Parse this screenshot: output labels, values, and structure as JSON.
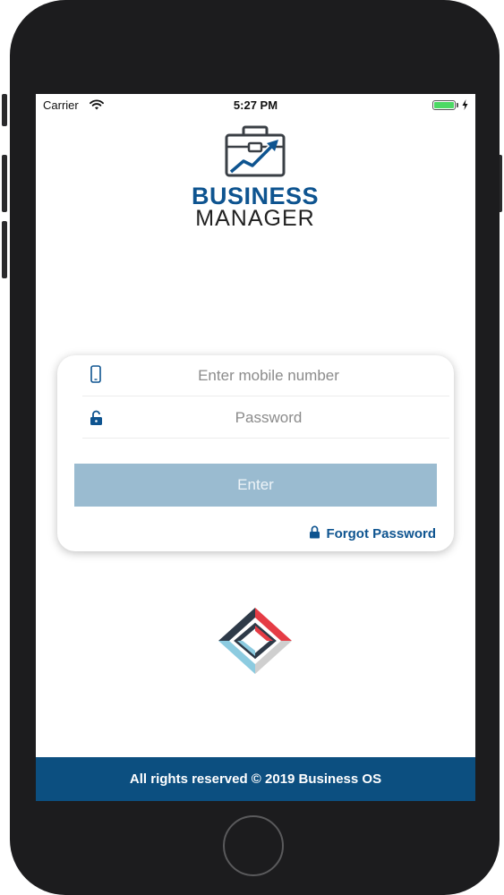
{
  "status_bar": {
    "carrier": "Carrier",
    "time": "5:27 PM",
    "battery_level_pct": 100
  },
  "logo": {
    "line1": "BUSINESS",
    "line2": "MANAGER",
    "icon": "briefcase-growth-icon"
  },
  "login": {
    "mobile": {
      "value": "",
      "placeholder": "Enter mobile number",
      "icon": "mobile-phone-icon"
    },
    "password": {
      "value": "",
      "placeholder": "Password",
      "icon": "lock-icon"
    },
    "enter_label": "Enter",
    "forgot_label": "Forgot Password",
    "forgot_icon": "lock-icon"
  },
  "brand_mark_icon": "diamond-logo-icon",
  "footer": {
    "text": "All rights reserved © 2019 Business OS"
  },
  "colors": {
    "brand_blue": "#0e5490",
    "button_disabled": "#9abbd0",
    "footer_bg": "#0c4f80",
    "logo_red": "#e53c45",
    "logo_dark": "#2e3a48",
    "logo_light_blue": "#8ccbe0",
    "logo_gray": "#cfcfcf"
  }
}
